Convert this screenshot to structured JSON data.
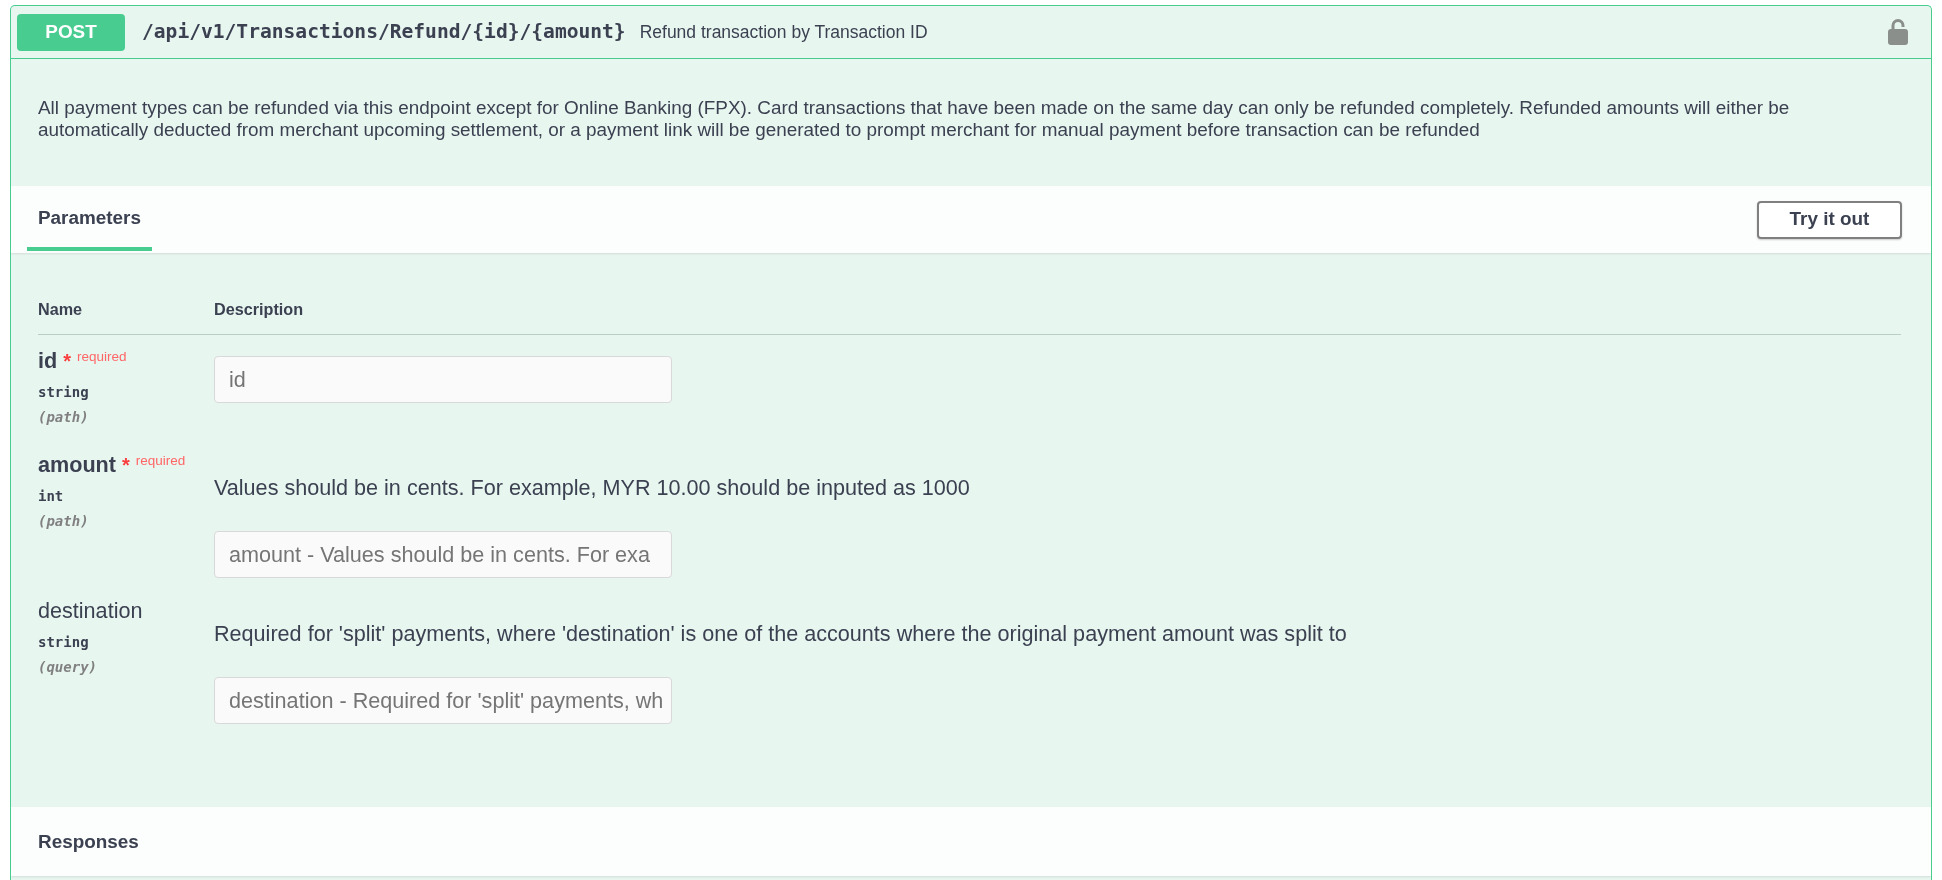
{
  "operation": {
    "method": "POST",
    "path": "/api/v1/Transactions/Refund/{id}/{amount}",
    "summary": "Refund transaction by Transaction ID",
    "description": "All payment types can be refunded via this endpoint except for Online Banking (FPX). Card transactions that have been made on the same day can only be refunded completely. Refunded amounts will either be automatically deducted from merchant upcoming settlement, or a payment link will be generated to prompt merchant for manual payment before transaction can be refunded"
  },
  "section_tabs": [
    {
      "label": "Parameters",
      "selected": true
    }
  ],
  "try_button": "Try it out",
  "parameters": {
    "columns": [
      "Name",
      "Description"
    ],
    "rows": [
      {
        "name": "id",
        "required": true,
        "required_mark": "*",
        "required_note": "required",
        "type": "string",
        "location": "(path)",
        "placeholder": "id"
      },
      {
        "name": "amount",
        "required": true,
        "required_mark": "*",
        "required_note": "required",
        "type": "int",
        "location": "(path)",
        "description": "Values should be in cents. For example, MYR 10.00 should be inputed as 1000",
        "placeholder": "amount - Values should be in cents. For exa"
      },
      {
        "name": "destination",
        "required": false,
        "type": "string",
        "location": "(query)",
        "description": "Required for 'split' payments, where 'destination' is one of the accounts where the original payment amount was split to",
        "placeholder": "destination - Required for 'split' payments, wh"
      }
    ]
  },
  "responses": {
    "title": "Responses"
  }
}
